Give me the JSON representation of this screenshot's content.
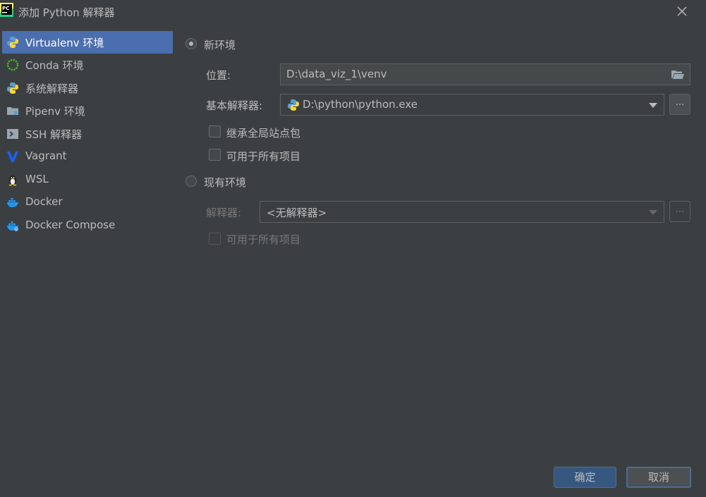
{
  "window": {
    "title": "添加 Python 解释器",
    "app_icon": "pycharm-logo-icon",
    "close_icon": "close-icon"
  },
  "sidebar": {
    "items": [
      {
        "label": "Virtualenv 环境",
        "icon": "virtualenv-python-icon",
        "selected": true
      },
      {
        "label": "Conda 环境",
        "icon": "conda-ring-icon"
      },
      {
        "label": "系统解释器",
        "icon": "python-icon"
      },
      {
        "label": "Pipenv 环境",
        "icon": "pipenv-folder-icon"
      },
      {
        "label": "SSH 解释器",
        "icon": "terminal-icon"
      },
      {
        "label": "Vagrant",
        "icon": "vagrant-v-icon"
      },
      {
        "label": "WSL",
        "icon": "linux-penguin-icon"
      },
      {
        "label": "Docker",
        "icon": "docker-whale-icon"
      },
      {
        "label": "Docker Compose",
        "icon": "docker-compose-icon"
      }
    ]
  },
  "new_env": {
    "radio_label": "新环境",
    "selected": true,
    "location_label": "位置:",
    "location_value": "D:\\data_viz_1\\venv",
    "base_interpreter_label": "基本解释器:",
    "base_interpreter_value": "D:\\python\\python.exe",
    "browse_label": "...",
    "inherit_label": "继承全局站点包",
    "all_projects_label": "可用于所有项目"
  },
  "existing_env": {
    "radio_label": "现有环境",
    "selected": false,
    "interpreter_label": "解释器:",
    "interpreter_value": "<无解释器>",
    "browse_label": "...",
    "all_projects_label": "可用于所有项目"
  },
  "buttons": {
    "ok_label": "确定",
    "cancel_label": "取消"
  },
  "colors": {
    "background": "#3c3f41",
    "selection": "#4b6eaf",
    "primary_button": "#365880"
  }
}
